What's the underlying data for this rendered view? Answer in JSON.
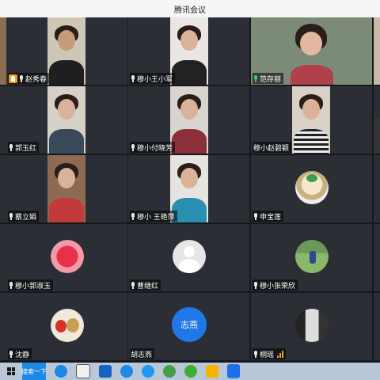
{
  "window": {
    "title": "腾讯会议"
  },
  "participants": [
    {
      "name": "赵秀春",
      "mic": "normal",
      "host": true
    },
    {
      "name": "穆小王小军",
      "mic": "normal"
    },
    {
      "name": "范存丽",
      "mic": "speaking",
      "active": true
    },
    {
      "name": "郭玉红",
      "mic": "normal"
    },
    {
      "name": "穆小付晓芳",
      "mic": "normal"
    },
    {
      "name": "穆小赵碧颖",
      "mic": "none"
    },
    {
      "name": "蔡立娟",
      "mic": "normal"
    },
    {
      "name": "穆小 王艳萍",
      "mic": "normal"
    },
    {
      "name": "申宝莲",
      "mic": "normal"
    },
    {
      "name": "穆小郭淑玉",
      "mic": "normal"
    },
    {
      "name": "曹继红",
      "mic": "normal"
    },
    {
      "name": "穆小张荣欣",
      "mic": "normal"
    },
    {
      "name": "沈静",
      "mic": "normal"
    },
    {
      "name": "胡志燕",
      "mic": "none",
      "avatar_text": "志燕"
    },
    {
      "name": "桐瑶",
      "mic": "normal",
      "signal": true
    }
  ],
  "taskbar": {
    "search_label": "搜索一下",
    "icons": [
      "start-icon",
      "cortana-icon",
      "store-icon",
      "mail-icon",
      "edge-icon",
      "browser-icon",
      "360-icon",
      "wechat-icon",
      "explorer-icon",
      "tencent-meeting-icon"
    ]
  },
  "colors": {
    "speaking": "#3ec46d",
    "avatar_blue": "#1f78e6",
    "host_badge": "#f29c1f"
  }
}
